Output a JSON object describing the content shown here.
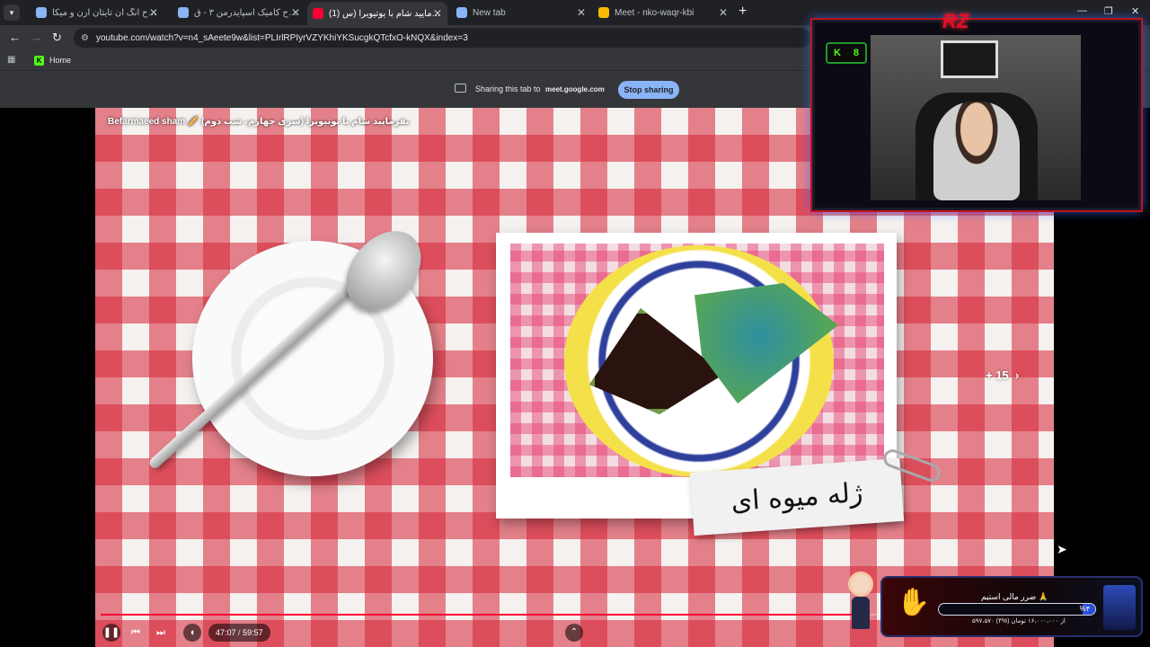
{
  "browser": {
    "tabs": [
      {
        "title": "قاب طرح انگ آن تایتان ارن و میکا",
        "favicon_color": "#8ab4f8",
        "active": false
      },
      {
        "title": "قاب طرح کامیک اسپایدرمن ۳ - ق",
        "favicon_color": "#8ab4f8",
        "active": false
      },
      {
        "title": "(1) بفرمایید شام با یوتیوبرا (س",
        "favicon_color": "#ff0033",
        "active": true
      },
      {
        "title": "New tab",
        "favicon_color": "#8ab4f8",
        "active": false
      },
      {
        "title": "Meet - nko-waqr-kbi",
        "favicon_color": "#fbbc04",
        "active": false
      }
    ],
    "url": "youtube.com/watch?v=n4_sAeete9w&list=PLIrlRPIyrVZYKhiYKSucgkQTcfxO-kNQX&index=3",
    "bookmarks": [
      {
        "label": "Home"
      }
    ]
  },
  "sharing": {
    "text": "Sharing this tab to",
    "domain": "meet.google.com",
    "stop_label": "Stop sharing"
  },
  "video": {
    "title": "Befarmaeed sham 🥖 بفرمایید شام با یوتیوبرا (سری چهارم، شب دوم)",
    "caption": "ژله میوه ای",
    "more_images": "+ 15",
    "progress": 0.7996,
    "time_current": "47:07",
    "time_separator": "/",
    "time_total": "59:57"
  },
  "webcam": {
    "logo": "RZ",
    "kick_logo": "K",
    "kick_count": "8"
  },
  "donation": {
    "title": "ضرر مالی استیم 🙏",
    "percent_label": "%۴",
    "percent": 0.04,
    "amount": "۵۹۷،۵۷۰ از ۱۶،۰۰۰،۰۰۰ تومان (%۴)"
  },
  "icons": {
    "back": "arrow-left-icon",
    "forward": "arrow-right-icon",
    "reload": "reload-icon",
    "site_info": "tune-icon",
    "apps": "apps-grid-icon",
    "pause": "pause-icon",
    "prev": "skip-previous-icon",
    "next": "skip-next-icon",
    "volume": "volume-icon"
  }
}
